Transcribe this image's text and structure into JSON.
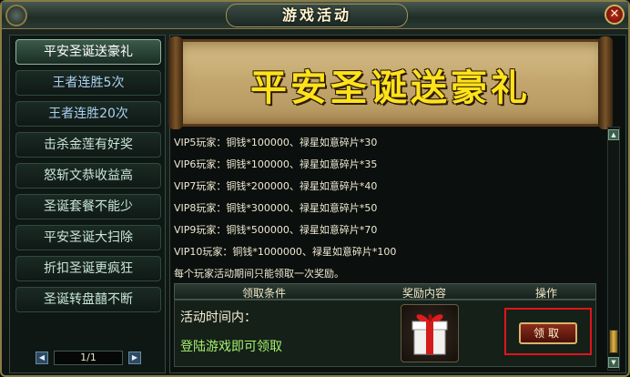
{
  "window": {
    "title": "游戏活动",
    "close_label": "✕"
  },
  "sidebar": {
    "items": [
      {
        "label": "平安圣诞送豪礼",
        "active": true
      },
      {
        "label": "王者连胜5次",
        "active": false
      },
      {
        "label": "王者连胜20次",
        "active": false
      },
      {
        "label": "击杀金莲有好奖",
        "active": false
      },
      {
        "label": "怒斩文恭收益高",
        "active": false
      },
      {
        "label": "圣诞套餐不能少",
        "active": false
      },
      {
        "label": "平安圣诞大扫除",
        "active": false
      },
      {
        "label": "折扣圣诞更疯狂",
        "active": false
      },
      {
        "label": "圣诞转盘囍不断",
        "active": false
      }
    ],
    "pager": {
      "prev": "◀",
      "page": "1/1",
      "next": "▶"
    }
  },
  "banner": {
    "title": "平安圣诞送豪礼"
  },
  "rewards": [
    "VIP5玩家：铜钱*100000、禄星如意碎片*30",
    "VIP6玩家：铜钱*100000、禄星如意碎片*35",
    "VIP7玩家：铜钱*200000、禄星如意碎片*40",
    "VIP8玩家：铜钱*300000、禄星如意碎片*50",
    "VIP9玩家：铜钱*500000、禄星如意碎片*70",
    "VIP10玩家：铜钱*1000000、禄星如意碎片*100",
    "每个玩家活动期间只能领取一次奖励。"
  ],
  "table": {
    "headers": {
      "condition": "领取条件",
      "reward": "奖励内容",
      "action": "操作"
    },
    "row": {
      "time_label": "活动时间内：",
      "condition": "登陆游戏即可领取",
      "button": "领取"
    }
  },
  "scrollbar": {
    "up": "▲",
    "down": "▼"
  },
  "colors": {
    "accent_gold": "#ffe21a",
    "highlight_red": "#e0151a",
    "condition_green": "#a6f06c"
  }
}
